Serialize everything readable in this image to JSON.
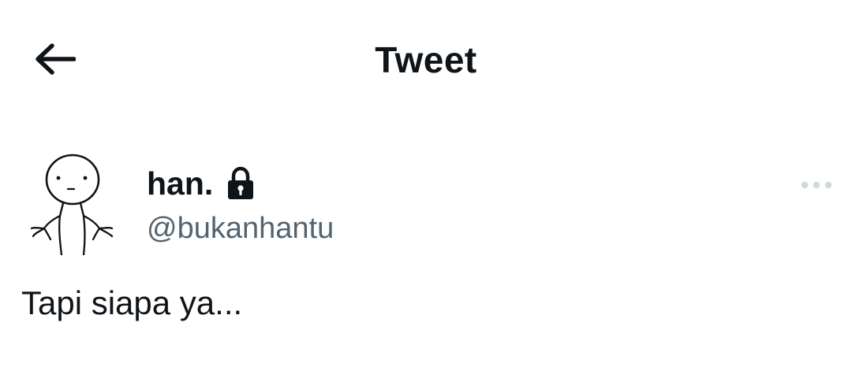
{
  "header": {
    "title": "Tweet",
    "back_icon": "arrow-left-icon"
  },
  "author": {
    "display_name": "han.",
    "handle": "@bukanhantu",
    "protected_icon": "lock-icon",
    "avatar_icon": "shrug-stickman-avatar"
  },
  "tweet": {
    "text": "Tapi siapa ya..."
  },
  "actions": {
    "more_icon": "more-dots-icon"
  },
  "colors": {
    "primary_text": "#0f1419",
    "secondary_text": "#536471",
    "more_dots": "#cfd9de",
    "background": "#ffffff"
  }
}
